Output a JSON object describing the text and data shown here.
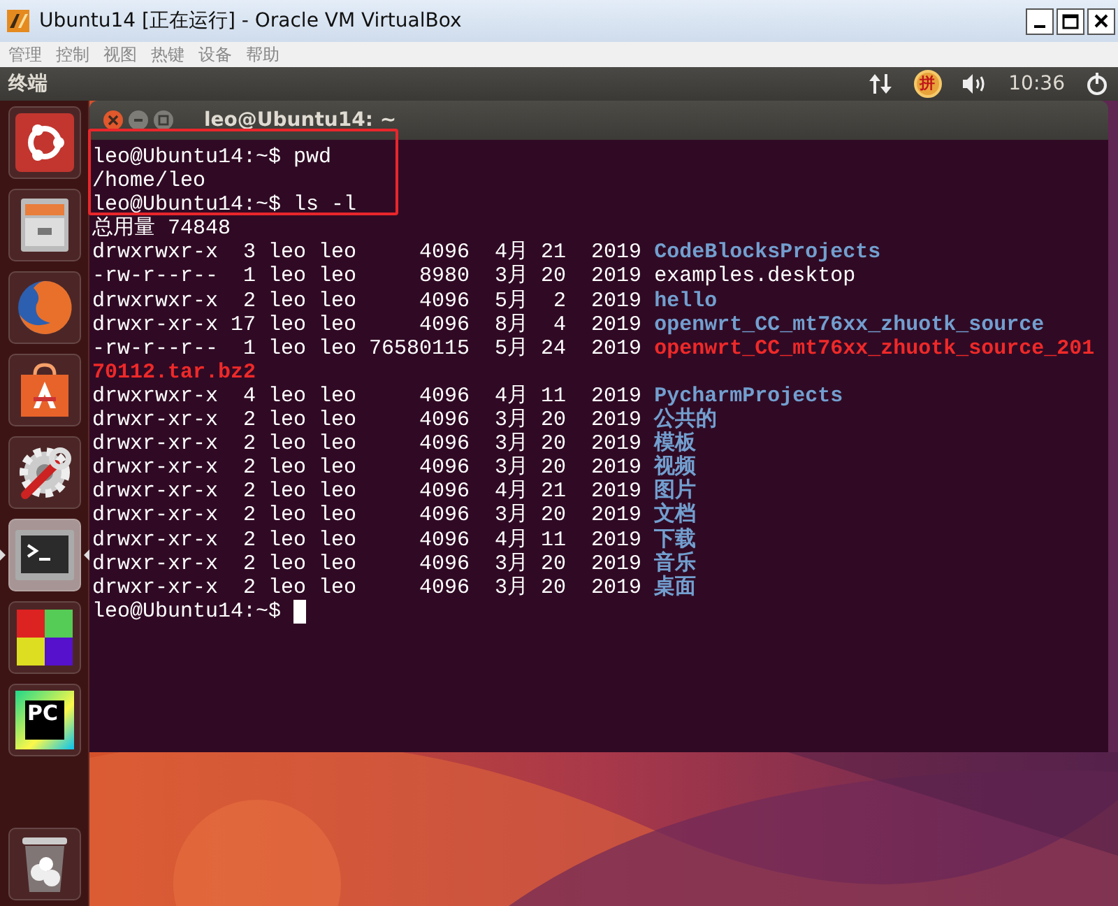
{
  "window": {
    "title": "Ubuntu14 [正在运行] - Oracle VM VirtualBox"
  },
  "menu": [
    "管理",
    "控制",
    "视图",
    "热键",
    "设备",
    "帮助"
  ],
  "top_panel": {
    "title": "终端",
    "input_method": "拼",
    "time": "10:36"
  },
  "launcher": [
    {
      "kind": "ubuntu",
      "selected": false
    },
    {
      "kind": "files",
      "selected": false
    },
    {
      "kind": "firefox",
      "selected": false
    },
    {
      "kind": "store",
      "selected": false
    },
    {
      "kind": "settings",
      "selected": false
    },
    {
      "kind": "terminal",
      "selected": true
    },
    {
      "kind": "blocks",
      "selected": false
    },
    {
      "kind": "pycharm",
      "selected": false,
      "label": "PC"
    },
    {
      "kind": "trash",
      "selected": false
    }
  ],
  "terminal": {
    "title": "leo@Ubuntu14: ~",
    "lines": [
      {
        "kind": "command",
        "prompt": "leo@Ubuntu14:~$",
        "command": "pwd",
        "highlighted": true
      },
      {
        "kind": "output",
        "text": "/home/leo",
        "highlighted": true
      },
      {
        "kind": "command",
        "prompt": "leo@Ubuntu14:~$",
        "command": "ls -l",
        "highlighted": true
      },
      {
        "kind": "output",
        "text": "总用量 74848"
      },
      {
        "kind": "dir",
        "info": "drwxrwxr-x  3 leo leo     4096  4月 21  2019",
        "name": "CodeBlocksProjects"
      },
      {
        "kind": "file",
        "info": "-rw-r--r--  1 leo leo     8980  3月 20  2019",
        "name": "examples.desktop"
      },
      {
        "kind": "dir",
        "info": "drwxrwxr-x  2 leo leo     4096  5月  2  2019",
        "name": "hello"
      },
      {
        "kind": "dir",
        "info": "drwxr-xr-x 17 leo leo     4096  8月  4  2019",
        "name": "openwrt_CC_mt76xx_zhuotk_source"
      },
      {
        "kind": "archive",
        "info": "-rw-r--r--  1 leo leo 76580115  5月 24  2019",
        "name": "openwrt_CC_mt76xx_zhuotk_source_201"
      },
      {
        "kind": "archive",
        "name": "70112.tar.bz2"
      },
      {
        "kind": "dir",
        "info": "drwxrwxr-x  4 leo leo     4096  4月 11  2019",
        "name": "PycharmProjects"
      },
      {
        "kind": "dir",
        "info": "drwxr-xr-x  2 leo leo     4096  3月 20  2019",
        "name": "公共的"
      },
      {
        "kind": "dir",
        "info": "drwxr-xr-x  2 leo leo     4096  3月 20  2019",
        "name": "模板"
      },
      {
        "kind": "dir",
        "info": "drwxr-xr-x  2 leo leo     4096  3月 20  2019",
        "name": "视频"
      },
      {
        "kind": "dir",
        "info": "drwxr-xr-x  2 leo leo     4096  4月 21  2019",
        "name": "图片"
      },
      {
        "kind": "dir",
        "info": "drwxr-xr-x  2 leo leo     4096  3月 20  2019",
        "name": "文档"
      },
      {
        "kind": "dir",
        "info": "drwxr-xr-x  2 leo leo     4096  4月 11  2019",
        "name": "下载"
      },
      {
        "kind": "dir",
        "info": "drwxr-xr-x  2 leo leo     4096  3月 20  2019",
        "name": "音乐"
      },
      {
        "kind": "dir",
        "info": "drwxr-xr-x  2 leo leo     4096  3月 20  2019",
        "name": "桌面"
      },
      {
        "kind": "command",
        "prompt": "leo@Ubuntu14:~$",
        "cursor": true
      }
    ]
  }
}
